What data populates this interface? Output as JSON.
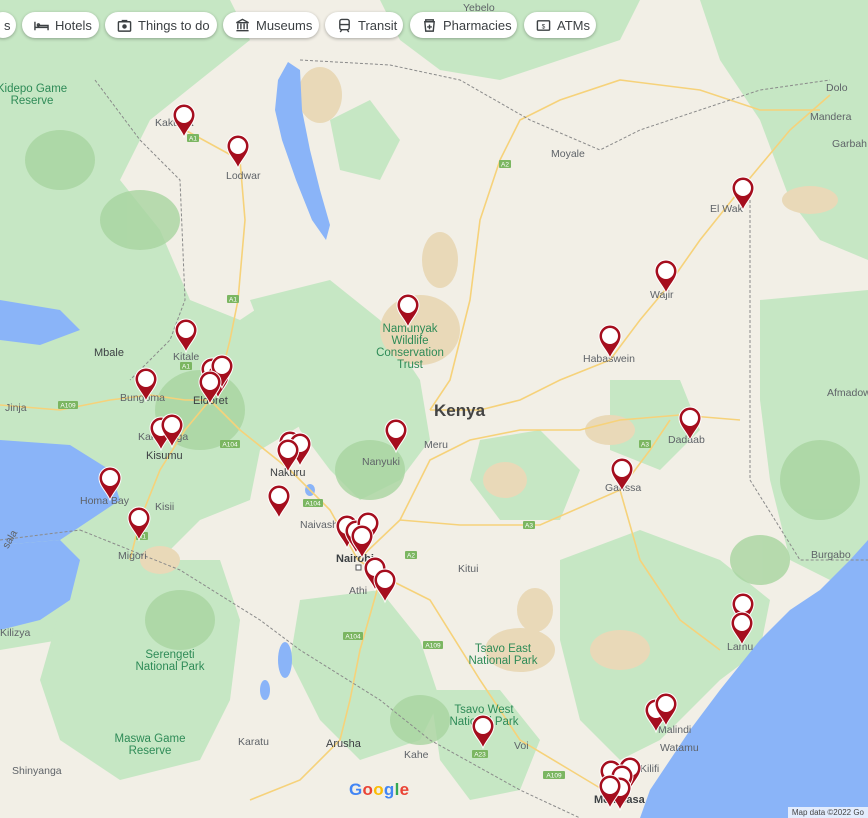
{
  "filters": [
    {
      "label": "s",
      "icon": "partial-chip"
    },
    {
      "label": "Hotels",
      "icon": "bed-icon"
    },
    {
      "label": "Things to do",
      "icon": "camera-icon"
    },
    {
      "label": "Museums",
      "icon": "museum-icon"
    },
    {
      "label": "Transit",
      "icon": "train-icon"
    },
    {
      "label": "Pharmacies",
      "icon": "pharmacy-icon"
    },
    {
      "label": "ATMs",
      "icon": "atm-icon"
    }
  ],
  "country_label": "Kenya",
  "place_labels": {
    "kakuma": "Kakuma",
    "lodwar": "Lodwar",
    "mbale": "Mbale",
    "kitale": "Kitale",
    "bungoma": "Bungoma",
    "eldoret": "Eldoret",
    "jinja": "Jinja",
    "kakamega": "Kakamega",
    "kisumu": "Kisumu",
    "homa_bay": "Homa Bay",
    "kisii": "Kisii",
    "migori": "Migori",
    "nakuru": "Nakuru",
    "naivasha": "Naivasha",
    "nairobi": "Nairobi",
    "athi": "Athi",
    "nanyuki": "Nanyuki",
    "meru": "Meru",
    "kitui": "Kitui",
    "moyale": "Moyale",
    "yebelo": "Yebelo",
    "dolo": "Dolo",
    "mandera": "Mandera",
    "garbah": "Garbah",
    "el_wak": "El Wak",
    "wajir": "Wajir",
    "habaswein": "Habaswein",
    "dadaab": "Dadaab",
    "afmadow": "Afmadow",
    "garissa": "Garissa",
    "burgabo": "Burgabo",
    "lamu": "Lamu",
    "malindi": "Malindi",
    "watamu": "Watamu",
    "kilifi": "Kilifi",
    "mombasa": "Mombasa",
    "voi": "Voi",
    "kahe": "Kahe",
    "arusha": "Arusha",
    "karatu": "Karatu",
    "shinyanga": "Shinyanga",
    "kilizya": "Kilizya",
    "sala": "sala"
  },
  "park_labels": {
    "kidepo": [
      "Kidepo Game",
      "Reserve"
    ],
    "namunyak": [
      "Namunyak",
      "Wildlife",
      "Conservation",
      "Trust"
    ],
    "tsavo_east": [
      "Tsavo East",
      "National Park"
    ],
    "tsavo_west": [
      "Tsavo West",
      "National Park"
    ],
    "serengeti": [
      "Serengeti",
      "National Park"
    ],
    "maswa": [
      "Maswa Game",
      "Reserve"
    ]
  },
  "road_shields": [
    "A1",
    "A1",
    "A2",
    "A1",
    "A109",
    "A104",
    "A104",
    "A2",
    "A3",
    "A104",
    "A109",
    "A23",
    "A109",
    "A1",
    "A3"
  ],
  "google_logo": "Google",
  "attribution": "Map data ©2022 Go",
  "colors": {
    "land": "#f2efe6",
    "green": "#c6e7c4",
    "green_dark": "#a8d5a0",
    "water": "#8ab4f8",
    "sand": "#e9d9b8",
    "pin": "#a50e1e",
    "road": "#f6d27a"
  },
  "markers": [
    {
      "place": "Kakuma"
    },
    {
      "place": "Lodwar"
    },
    {
      "place": "El Wak"
    },
    {
      "place": "Wajir"
    },
    {
      "place": "Namunyak"
    },
    {
      "place": "Habaswein"
    },
    {
      "place": "Kitale"
    },
    {
      "place": "Bungoma"
    },
    {
      "place": "Eldoret"
    },
    {
      "place": "Eldoret"
    },
    {
      "place": "Eldoret"
    },
    {
      "place": "Eldoret"
    },
    {
      "place": "Kakamega"
    },
    {
      "place": "Kakamega"
    },
    {
      "place": "Dadaab"
    },
    {
      "place": "Nanyuki"
    },
    {
      "place": "Nakuru"
    },
    {
      "place": "Nakuru"
    },
    {
      "place": "Nakuru"
    },
    {
      "place": "Homa Bay"
    },
    {
      "place": "Garissa"
    },
    {
      "place": "Naivasha"
    },
    {
      "place": "Migori"
    },
    {
      "place": "Nairobi"
    },
    {
      "place": "Nairobi"
    },
    {
      "place": "Nairobi"
    },
    {
      "place": "Nairobi"
    },
    {
      "place": "Athi"
    },
    {
      "place": "Athi"
    },
    {
      "place": "Lamu"
    },
    {
      "place": "Lamu"
    },
    {
      "place": "Malindi"
    },
    {
      "place": "Malindi"
    },
    {
      "place": "Voi"
    },
    {
      "place": "Kilifi"
    },
    {
      "place": "Mombasa"
    },
    {
      "place": "Mombasa"
    },
    {
      "place": "Mombasa"
    },
    {
      "place": "Mombasa"
    }
  ]
}
